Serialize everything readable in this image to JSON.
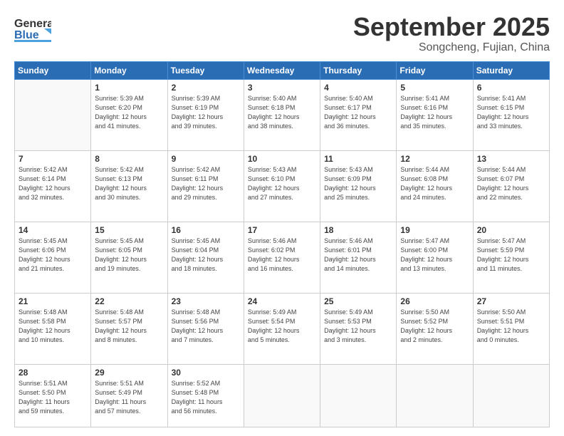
{
  "header": {
    "logo_general": "General",
    "logo_blue": "Blue",
    "month": "September 2025",
    "location": "Songcheng, Fujian, China"
  },
  "weekdays": [
    "Sunday",
    "Monday",
    "Tuesday",
    "Wednesday",
    "Thursday",
    "Friday",
    "Saturday"
  ],
  "weeks": [
    [
      {
        "day": "",
        "info": ""
      },
      {
        "day": "1",
        "info": "Sunrise: 5:39 AM\nSunset: 6:20 PM\nDaylight: 12 hours\nand 41 minutes."
      },
      {
        "day": "2",
        "info": "Sunrise: 5:39 AM\nSunset: 6:19 PM\nDaylight: 12 hours\nand 39 minutes."
      },
      {
        "day": "3",
        "info": "Sunrise: 5:40 AM\nSunset: 6:18 PM\nDaylight: 12 hours\nand 38 minutes."
      },
      {
        "day": "4",
        "info": "Sunrise: 5:40 AM\nSunset: 6:17 PM\nDaylight: 12 hours\nand 36 minutes."
      },
      {
        "day": "5",
        "info": "Sunrise: 5:41 AM\nSunset: 6:16 PM\nDaylight: 12 hours\nand 35 minutes."
      },
      {
        "day": "6",
        "info": "Sunrise: 5:41 AM\nSunset: 6:15 PM\nDaylight: 12 hours\nand 33 minutes."
      }
    ],
    [
      {
        "day": "7",
        "info": "Sunrise: 5:42 AM\nSunset: 6:14 PM\nDaylight: 12 hours\nand 32 minutes."
      },
      {
        "day": "8",
        "info": "Sunrise: 5:42 AM\nSunset: 6:13 PM\nDaylight: 12 hours\nand 30 minutes."
      },
      {
        "day": "9",
        "info": "Sunrise: 5:42 AM\nSunset: 6:11 PM\nDaylight: 12 hours\nand 29 minutes."
      },
      {
        "day": "10",
        "info": "Sunrise: 5:43 AM\nSunset: 6:10 PM\nDaylight: 12 hours\nand 27 minutes."
      },
      {
        "day": "11",
        "info": "Sunrise: 5:43 AM\nSunset: 6:09 PM\nDaylight: 12 hours\nand 25 minutes."
      },
      {
        "day": "12",
        "info": "Sunrise: 5:44 AM\nSunset: 6:08 PM\nDaylight: 12 hours\nand 24 minutes."
      },
      {
        "day": "13",
        "info": "Sunrise: 5:44 AM\nSunset: 6:07 PM\nDaylight: 12 hours\nand 22 minutes."
      }
    ],
    [
      {
        "day": "14",
        "info": "Sunrise: 5:45 AM\nSunset: 6:06 PM\nDaylight: 12 hours\nand 21 minutes."
      },
      {
        "day": "15",
        "info": "Sunrise: 5:45 AM\nSunset: 6:05 PM\nDaylight: 12 hours\nand 19 minutes."
      },
      {
        "day": "16",
        "info": "Sunrise: 5:45 AM\nSunset: 6:04 PM\nDaylight: 12 hours\nand 18 minutes."
      },
      {
        "day": "17",
        "info": "Sunrise: 5:46 AM\nSunset: 6:02 PM\nDaylight: 12 hours\nand 16 minutes."
      },
      {
        "day": "18",
        "info": "Sunrise: 5:46 AM\nSunset: 6:01 PM\nDaylight: 12 hours\nand 14 minutes."
      },
      {
        "day": "19",
        "info": "Sunrise: 5:47 AM\nSunset: 6:00 PM\nDaylight: 12 hours\nand 13 minutes."
      },
      {
        "day": "20",
        "info": "Sunrise: 5:47 AM\nSunset: 5:59 PM\nDaylight: 12 hours\nand 11 minutes."
      }
    ],
    [
      {
        "day": "21",
        "info": "Sunrise: 5:48 AM\nSunset: 5:58 PM\nDaylight: 12 hours\nand 10 minutes."
      },
      {
        "day": "22",
        "info": "Sunrise: 5:48 AM\nSunset: 5:57 PM\nDaylight: 12 hours\nand 8 minutes."
      },
      {
        "day": "23",
        "info": "Sunrise: 5:48 AM\nSunset: 5:56 PM\nDaylight: 12 hours\nand 7 minutes."
      },
      {
        "day": "24",
        "info": "Sunrise: 5:49 AM\nSunset: 5:54 PM\nDaylight: 12 hours\nand 5 minutes."
      },
      {
        "day": "25",
        "info": "Sunrise: 5:49 AM\nSunset: 5:53 PM\nDaylight: 12 hours\nand 3 minutes."
      },
      {
        "day": "26",
        "info": "Sunrise: 5:50 AM\nSunset: 5:52 PM\nDaylight: 12 hours\nand 2 minutes."
      },
      {
        "day": "27",
        "info": "Sunrise: 5:50 AM\nSunset: 5:51 PM\nDaylight: 12 hours\nand 0 minutes."
      }
    ],
    [
      {
        "day": "28",
        "info": "Sunrise: 5:51 AM\nSunset: 5:50 PM\nDaylight: 11 hours\nand 59 minutes."
      },
      {
        "day": "29",
        "info": "Sunrise: 5:51 AM\nSunset: 5:49 PM\nDaylight: 11 hours\nand 57 minutes."
      },
      {
        "day": "30",
        "info": "Sunrise: 5:52 AM\nSunset: 5:48 PM\nDaylight: 11 hours\nand 56 minutes."
      },
      {
        "day": "",
        "info": ""
      },
      {
        "day": "",
        "info": ""
      },
      {
        "day": "",
        "info": ""
      },
      {
        "day": "",
        "info": ""
      }
    ]
  ]
}
